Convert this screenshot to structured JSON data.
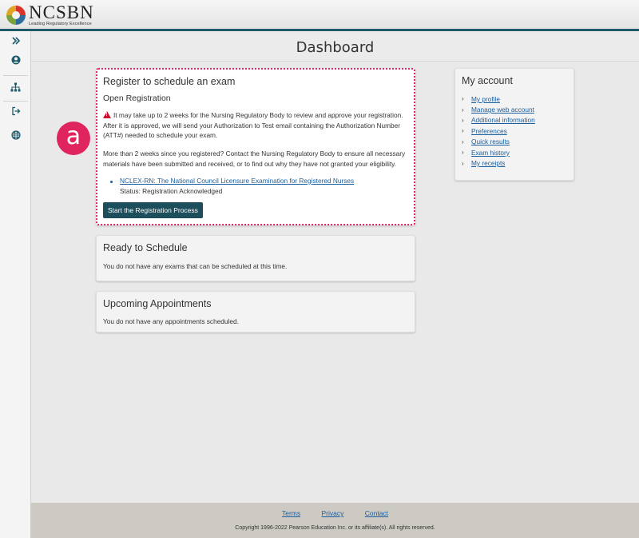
{
  "header": {
    "logo_name": "NCSBN",
    "logo_tagline": "Leading Regulatory Excellence"
  },
  "sidebar": {
    "icons": [
      "expand-icon",
      "user-icon",
      "sitemap-icon",
      "sign-out-icon",
      "globe-icon"
    ]
  },
  "page": {
    "title": "Dashboard"
  },
  "registration": {
    "title": "Register to schedule an exam",
    "subtitle": "Open Registration",
    "warning": "It may take up to 2 weeks for the Nursing Regulatory Body to review and approve your registration. After it is approved, we will send your Authorization to Test email containing the Authorization Number (ATT#) needed to schedule your exam.",
    "more_info": "More than 2 weeks since you registered? Contact the Nursing Regulatory Body to ensure all necessary materials have been submitted and received, or to find out why they have not granted your eligibility.",
    "exam_link": "NCLEX-RN: The National Council Licensure Examination for Registered Nurses",
    "exam_status": "Status: Registration Acknowledged",
    "button_label": "Start the Registration Process"
  },
  "ready": {
    "title": "Ready to Schedule",
    "message": "You do not have any exams that can be scheduled at this time."
  },
  "appointments": {
    "title": "Upcoming Appointments",
    "message": "You do not have any appointments scheduled."
  },
  "account": {
    "title": "My account",
    "links": [
      "My profile",
      "Manage web account",
      "Additional information",
      "Preferences",
      "Quick results",
      "Exam history",
      "My receipts"
    ]
  },
  "annotation": {
    "badge": "a"
  },
  "footer": {
    "links": [
      "Terms",
      "Privacy",
      "Contact"
    ],
    "copyright": "Copyright 1996-2022 Pearson Education Inc. or its affiliate(s). All rights reserved."
  },
  "colors": {
    "accent": "#1f5a6b",
    "button": "#1c4e5b",
    "link": "#1b5e9e",
    "highlight": "#e0245e",
    "warning": "#c8102e"
  }
}
